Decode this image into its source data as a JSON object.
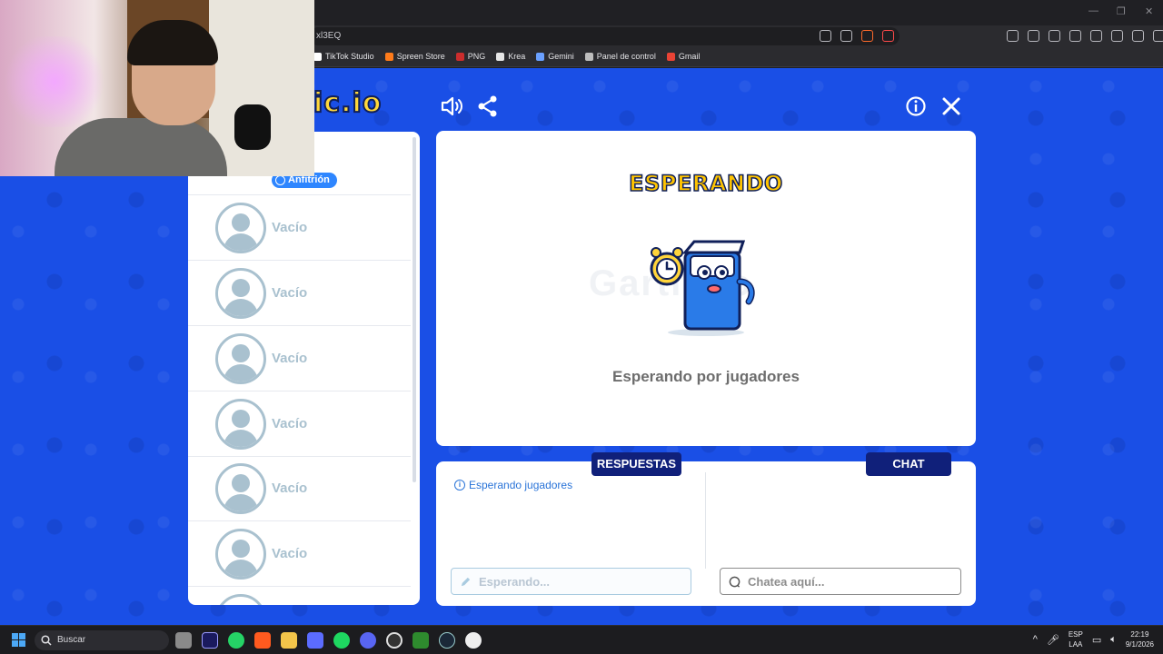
{
  "browser": {
    "url_fragment": "xl3EQ",
    "window_controls": [
      "minimize-icon",
      "restore-icon",
      "close-icon"
    ],
    "bookmarks": [
      {
        "label": "TikTok Studio",
        "icon": "tiktok-icon",
        "color": "#ffffff"
      },
      {
        "label": "Spreen Store",
        "icon": "spreen-icon",
        "color": "#ff7b1a"
      },
      {
        "label": "PNG",
        "icon": "png-icon",
        "color": "#cc2d2d"
      },
      {
        "label": "Krea",
        "icon": "krea-icon",
        "color": "#e6e6e6"
      },
      {
        "label": "Gemini",
        "icon": "gemini-icon",
        "color": "#6aa0ff"
      },
      {
        "label": "Panel de control",
        "icon": "link-icon",
        "color": "#bdbdbd"
      },
      {
        "label": "Gmail",
        "icon": "gmail-icon",
        "color": "#ea4335"
      }
    ]
  },
  "game": {
    "logo_partial": "ic.io",
    "top_icons": [
      "speaker-icon",
      "share-icon",
      "info-icon",
      "close-icon"
    ],
    "host_badge": "Anfitrión",
    "empty_slot_label": "Vacío",
    "slots": [
      {
        "label": "Vacío"
      },
      {
        "label": "Vacío"
      },
      {
        "label": "Vacío"
      },
      {
        "label": "Vacío"
      },
      {
        "label": "Vacío"
      },
      {
        "label": "Vacío"
      }
    ],
    "waiting": {
      "title": "ESPERANDO",
      "subtitle": "Esperando por jugadores"
    },
    "answers": {
      "tab": "RESPUESTAS",
      "info": "Esperando jugadores",
      "placeholder": "Esperando..."
    },
    "chat": {
      "tab": "CHAT",
      "placeholder": "Chatea aquí..."
    },
    "colors": {
      "background": "#1a4fe6",
      "tab": "#10207a",
      "title_yellow": "#ffc400",
      "accent_blue": "#2e86ff"
    }
  },
  "taskbar": {
    "search_label": "Buscar",
    "apps": [
      "file-explorer-icon",
      "premiere-icon",
      "whatsapp-icon",
      "brave-icon",
      "folder-icon",
      "store-icon",
      "spotify-icon",
      "discord-icon",
      "obs-icon",
      "minecraft-icon",
      "steam-icon",
      "clock-app-icon"
    ],
    "language": "ESP",
    "layout": "LAA",
    "time": "22:19",
    "date": "9/1/2026"
  }
}
